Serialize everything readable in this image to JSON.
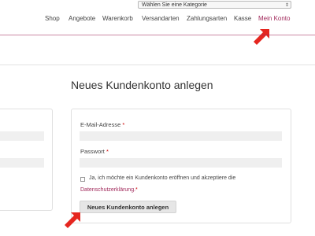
{
  "header": {
    "category_select": "Wählen Sie eine Kategorie",
    "nav": [
      "Shop",
      "Angebote",
      "Warenkorb",
      "Versandarten",
      "Zahlungsarten",
      "Kasse",
      "Mein Konto"
    ]
  },
  "main": {
    "title": "Neues Kundenkonto anlegen",
    "form": {
      "email_label": "E-Mail-Adresse",
      "password_label": "Passwort",
      "required_marker": "*",
      "consent_text": "Ja, ich möchte ein Kundenkonto eröffnen und akzeptiere die",
      "privacy_link": "Datenschutzerklärung.",
      "submit_label": "Neues Kundenkonto anlegen"
    }
  },
  "colors": {
    "accent": "#a0285a",
    "arrow": "#e5261f"
  },
  "icons": [
    "select-arrows-icon",
    "red-pointer-arrow-icon"
  ]
}
